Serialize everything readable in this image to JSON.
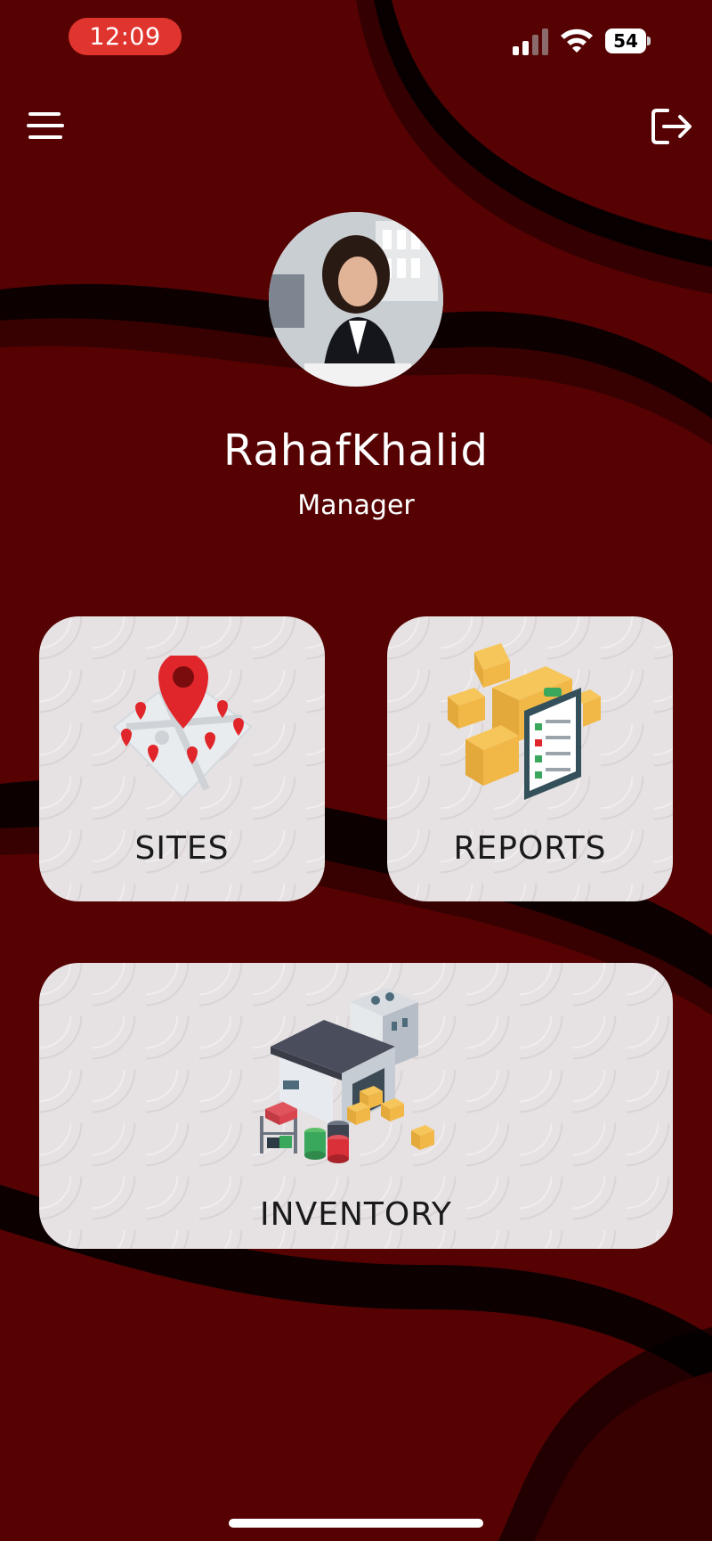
{
  "status_bar": {
    "time": "12:09",
    "battery": "54"
  },
  "profile": {
    "name": "RahafKhalid",
    "role": "Manager"
  },
  "tiles": {
    "sites": "SITES",
    "reports": "REPORTS",
    "inventory": "INVENTORY"
  },
  "icons": {
    "menu": "hamburger-menu-icon",
    "logout": "logout-icon"
  },
  "colors": {
    "background": "#560203",
    "status_pill": "#e0352f",
    "tile": "#e6e1e2"
  }
}
